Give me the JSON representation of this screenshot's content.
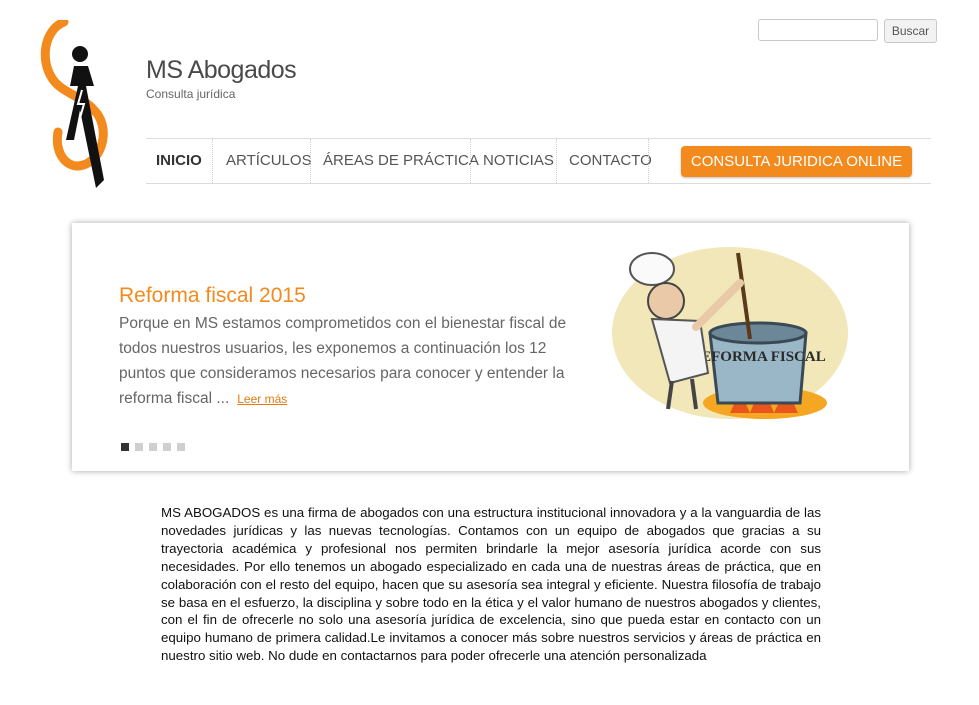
{
  "site": {
    "title": "MS Abogados",
    "subtitle": "Consulta jurídica"
  },
  "search": {
    "placeholder": "",
    "button_label": "Buscar"
  },
  "nav": {
    "items": [
      {
        "label": "INICIO",
        "active": true
      },
      {
        "label": "ARTÍCULOS",
        "active": false
      },
      {
        "label": "ÁREAS DE PRÁCTICA",
        "active": false
      },
      {
        "label": "NOTICIAS",
        "active": false
      },
      {
        "label": "CONTACTO",
        "active": false
      }
    ],
    "cta_label": "CONSULTA JURIDICA ONLINE"
  },
  "slider": {
    "title": "Reforma fiscal 2015",
    "text": "Porque en MS estamos comprometidos con el bienestar fiscal de todos nuestros usuarios, les exponemos a continuación los 12 puntos que consideramos necesarios para conocer y entender la reforma fiscal ...",
    "read_more": "Leer más",
    "image_caption": "REFORMA FISCAL",
    "dots_count": 5,
    "active_dot": 1
  },
  "intro": {
    "text": "MS ABOGADOS es una firma de abogados con una estructura institucional innovadora y a la vanguardia de las novedades jurídicas y las nuevas tecnologías. Contamos con un equipo de abogados que gracias a su trayectoria académica y profesional nos permiten brindarle la mejor asesoría jurídica acorde con sus necesidades. Por ello tenemos un abogado especializado en cada una de nuestras áreas de práctica, que en colaboración con el resto del equipo, hacen que su asesoría sea integral y eficiente. Nuestra filosofía de trabajo se basa en el esfuerzo, la disciplina y sobre todo en la ética y el valor humano de nuestros abogados y clientes, con el fin de ofrecerle no solo una asesoría jurídica de excelencia, sino que pueda estar en contacto con un equipo humano de primera calidad.Le invitamos a conocer más sobre nuestros servicios y áreas de práctica en nuestro sitio web. No dude en contactarnos para poder ofrecerle una atención personalizada"
  },
  "colors": {
    "accent": "#f28a1e",
    "text": "#333333"
  }
}
